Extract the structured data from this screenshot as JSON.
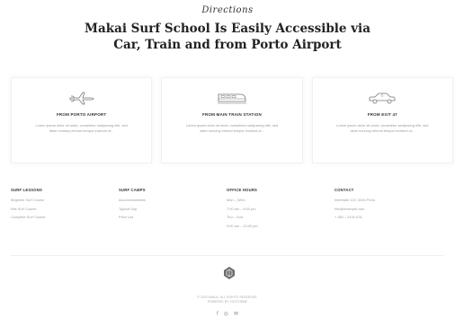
{
  "header": {
    "script_title": "Directions",
    "headline_line1": "Makai Surf School Is Easily Accessible via",
    "headline_line2": "Car, Train and from Porto Airport"
  },
  "cards": [
    {
      "icon": "airplane-icon",
      "title": "FROM PORTO AIRPORT",
      "text": "Lorem ipsum dolor sit amet, consetetur sadipscing elitr, sed diam nonumy eirmod tempor invidunt ut..."
    },
    {
      "icon": "train-icon",
      "title": "FROM MAIN TRAIN STATION",
      "text": "Lorem ipsum dolor sit amet, consetetur sadipscing elitr, sed diam nonumy eirmod tempor invidunt ut..."
    },
    {
      "icon": "car-icon",
      "title": "FROM EXIT 47",
      "text": "Lorem ipsum dolor sit amet, consetetur sadipscing elitr, sed diam nonumy eirmod tempor invidunt ut..."
    }
  ],
  "footer": {
    "columns": [
      {
        "heading": "SURF LESSONS",
        "items": [
          "Beginner Surf Course",
          "Kite Surf Course",
          "Complete Surf Course"
        ]
      },
      {
        "heading": "SURF CAMPS",
        "items": [
          "Accommodations",
          "Typical Day",
          "Price List"
        ]
      },
      {
        "heading": "OFFICE HOURS",
        "items": [
          "Mon – Wed:",
          "7:00 am – 9:00 pm",
          "Thu – Sun:",
          "9:00 am – 10:00 pm"
        ]
      },
      {
        "heading": "CONTACT",
        "items": [
          "Interstate 122, 5346 Porto",
          "info@example.com",
          "+ 380 – 3134 678"
        ]
      }
    ],
    "copyright_line1": "© 2023 MAKAI. ALL RIGHTS RESERVED.",
    "copyright_line2": "POWERED BY YOOTHEME",
    "socials": [
      "facebook-icon",
      "instagram-icon",
      "email-icon"
    ]
  }
}
